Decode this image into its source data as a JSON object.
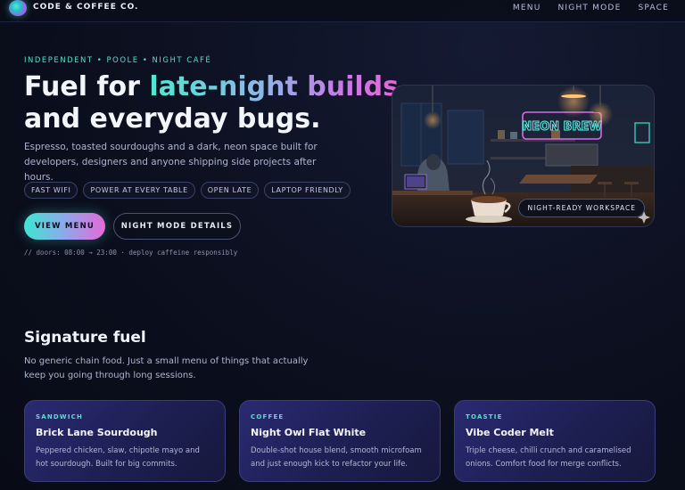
{
  "nav": {
    "brand": "CODE & COFFEE CO.",
    "links": [
      "MENU",
      "NIGHT MODE",
      "SPACE"
    ]
  },
  "hero": {
    "eyebrow": "INDEPENDENT • POOLE • NIGHT CAFÉ",
    "title_part1": "Fuel for ",
    "title_highlight": "late-night builds",
    "title_part2": "and everyday bugs.",
    "description": "Espresso, toasted sourdoughs and a dark, neon space built for developers, designers and anyone shipping side projects after hours.",
    "chips": [
      "FAST WIFI",
      "POWER AT EVERY TABLE",
      "OPEN LATE",
      "LAPTOP FRIENDLY"
    ],
    "primary_button": "VIEW MENU",
    "secondary_button": "NIGHT MODE DETAILS",
    "code_note": "// doors: 08:00 → 23:00 · deploy caffeine responsibly",
    "image_badge": "NIGHT-READY WORKSPACE",
    "neon_sign": "NEON BREW"
  },
  "section": {
    "title": "Signature fuel",
    "description": "No generic chain food. Just a small menu of things that actually keep you going through long sessions.",
    "cards": [
      {
        "tag": "SANDWICH",
        "title": "Brick Lane Sourdough",
        "desc": "Peppered chicken, slaw, chipotle mayo and hot sourdough. Built for big commits."
      },
      {
        "tag": "COFFEE",
        "title": "Night Owl Flat White",
        "desc": "Double-shot house blend, smooth microfoam and just enough kick to refactor your life."
      },
      {
        "tag": "TOASTIE",
        "title": "Vibe Coder Melt",
        "desc": "Triple cheese, chilli crunch and caramelised onions. Comfort food for merge conflicts."
      }
    ]
  },
  "colors": {
    "accent_teal": "#4fe0c9",
    "accent_pink": "#e766d2",
    "background": "#0b0f1e"
  }
}
